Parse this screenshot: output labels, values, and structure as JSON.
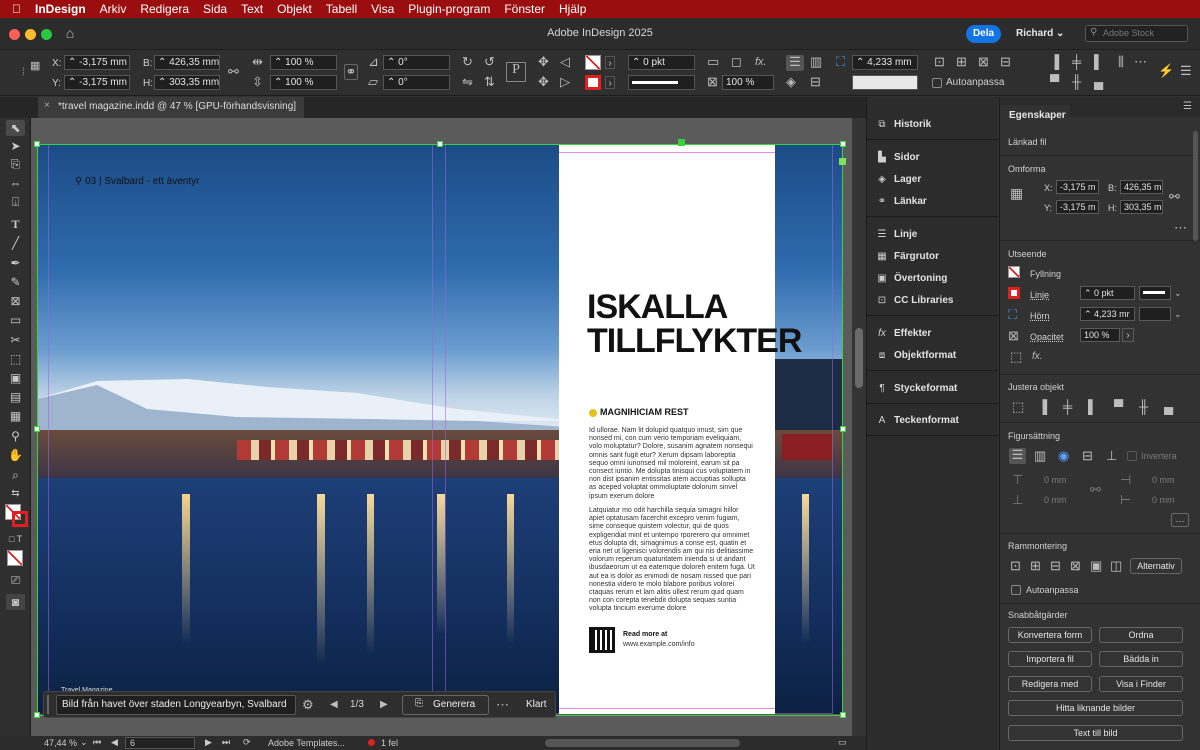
{
  "menubar": {
    "app": "InDesign",
    "items": [
      "Arkiv",
      "Redigera",
      "Sida",
      "Text",
      "Objekt",
      "Tabell",
      "Visa",
      "Plugin-program",
      "Fönster",
      "Hjälp"
    ]
  },
  "titlebar": {
    "title": "Adobe InDesign 2025",
    "share": "Dela",
    "user": "Richard",
    "stock_placeholder": "Adobe Stock"
  },
  "control": {
    "x": "-3,175 mm",
    "y": "-3,175 mm",
    "w": "426,35 mm",
    "h": "303,35 mm",
    "scale_x": "100 %",
    "scale_y": "100 %",
    "rotate": "0°",
    "shear": "0°",
    "stroke_weight": "0 pkt",
    "opacity": "100 %",
    "corner": "4,233 mm",
    "autofit": "Autoanpassa",
    "labels": {
      "x": "X:",
      "y": "Y:",
      "w": "B:",
      "h": "H:"
    }
  },
  "document_tab": "*travel magazine.indd @ 47 % [GPU-förhandsvisning]",
  "spread": {
    "location": "03 | Svalbard - ett äventyr",
    "headline_1": "ISKALLA",
    "headline_2": "TILLFLYKTER",
    "subhead": "MAGNIHICIAM REST",
    "para1": "Id ullorae. Nam lit dolupid quatquo imust, sim que nonsed mi, con cum verio temporiam eveliquiam, volo moluptatur? Dolore, susanim agnatem nonsequi omnis sant fugit etur? Xerum dipsam laboreptia sequo omni iurionsed mil moloreint, earum sit pa consect iuntio. Me dolupta tinisqui cus voluptatem in non dist ipsanim entissitas atem accuptias sollupta as aceped voluptat ommoluptate dolorum sinvel ipsum exerum dolore",
    "para2": "Latquiatur mo odit harchilla sequia simagni hillor apiet optatusam facerchit excepro venim fugiam, sime conseque quistem volectur, qui de quos expligendiat mint et untempo rporerero qui omnimet etus dolupta dit, simagnimus a conse est, quatin et eria net ut ligenisci volorendis am qui nis delitiassime volorum reperum quaturitatem iniendа si ut andant ibusdaeorum ut ea eatemque doloreh enitem fuga. Ut aut ea is dolor as enimodi de nosam nissed que pari nonestia videro te molo blabore poribus volorei ctaquas rerum et lam alitis ullest rerum quid quam non con corepta tenebdit dolupta sequas suntia volupta tincium exerume dolore",
    "read_more": "Read more at",
    "url": "www.example.com/info",
    "footer_tag": "Travel Magazine"
  },
  "generate_bar": {
    "caption": "Bild från havet över staden Longyearbyn, Svalbard",
    "counter": "1/3",
    "generate": "Generera",
    "done": "Klart"
  },
  "status": {
    "zoom": "47,44 %",
    "page": "6",
    "template": "Adobe Templates...",
    "errors": "1 fel"
  },
  "dock": {
    "items": [
      "Historik",
      "Sidor",
      "Lager",
      "Länkar",
      "Linje",
      "Färgrutor",
      "Övertoning",
      "CC Libraries",
      "Effekter",
      "Objektformat",
      "Styckeformat",
      "Teckenformat"
    ]
  },
  "properties": {
    "tab": "Egenskaper",
    "linked": "Länkad fil",
    "transform": "Omforma",
    "x": "-3,175 m",
    "y": "-3,175 m",
    "w": "426,35 m",
    "h": "303,35 m",
    "labels": {
      "x": "X:",
      "y": "Y:",
      "w": "B:",
      "h": "H:"
    },
    "appearance": "Utseende",
    "fill": "Fyllning",
    "stroke": "Linje",
    "corners": "Hörn",
    "opacity": "Opacitet",
    "stroke_val": "0 pkt",
    "corner_val": "4,233 mr",
    "opacity_val": "100 %",
    "align": "Justera objekt",
    "wrap": "Figursättning",
    "invert": "Invertera",
    "zero": "0 mm",
    "frame_fit": "Rammontering",
    "options": "Alternativ",
    "autofit": "Autoanpassa",
    "quick": "Snabbåtgärder",
    "buttons": [
      "Konvertera form",
      "Ordna",
      "Importera fil",
      "Bädda in",
      "Redigera med",
      "Visa i Finder",
      "Hitta liknande bilder",
      "Text till bild"
    ]
  },
  "colors": {
    "menubar": "#9b0e10",
    "accent": "#1473e6",
    "frame": "#37d33a"
  }
}
